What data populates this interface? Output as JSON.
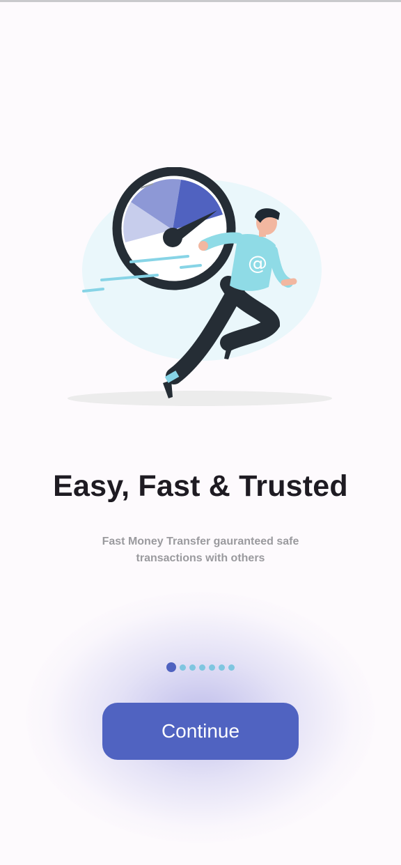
{
  "onboarding": {
    "title": "Easy, Fast & Trusted",
    "subtitle": "Fast Money Transfer gauranteed safe transactions with others",
    "continue_label": "Continue",
    "page_indicator": {
      "total": 7,
      "current": 1
    },
    "illustration_icon": "speedometer-runner-illustration",
    "shirt_glyph": "@"
  },
  "colors": {
    "accent": "#5063c1",
    "dot_inactive": "#7fc6e0",
    "title": "#1e1b22",
    "subtitle": "#9a9a9e"
  }
}
